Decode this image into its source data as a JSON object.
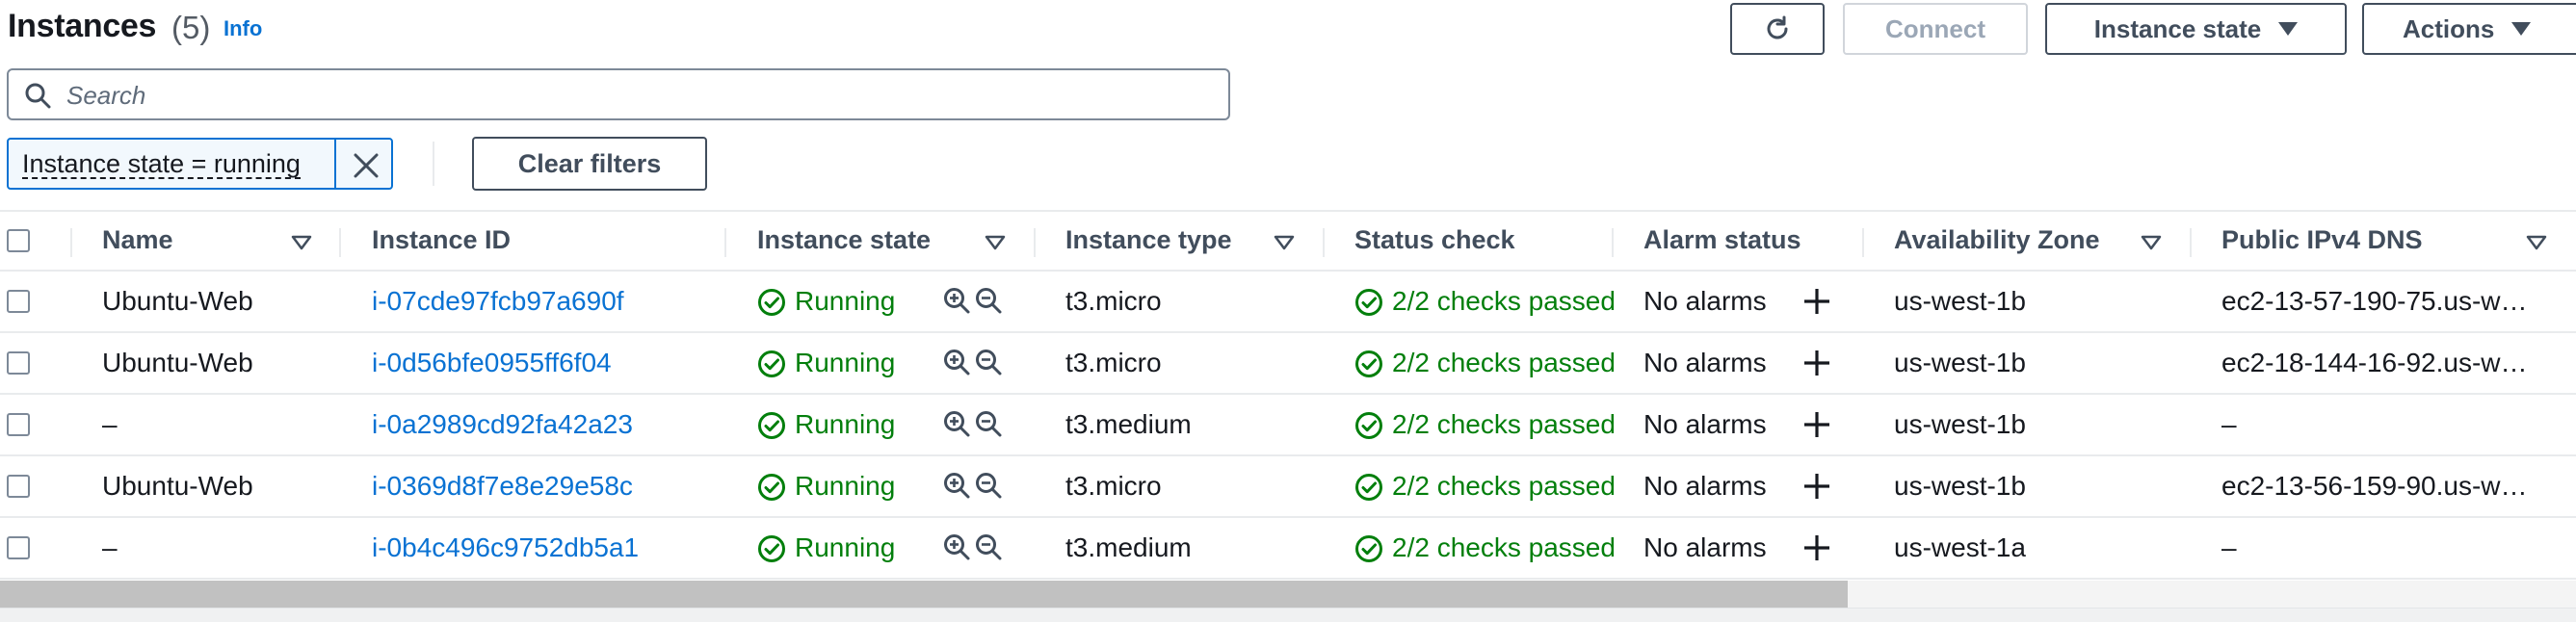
{
  "header": {
    "title": "Instances",
    "count": "(5)",
    "info": "Info",
    "refresh_icon": "refresh-icon",
    "connect_label": "Connect",
    "instance_state_label": "Instance state",
    "actions_label": "Actions"
  },
  "search": {
    "placeholder": "Search",
    "value": ""
  },
  "filter": {
    "token": "Instance state = running",
    "clear_label": "Clear filters"
  },
  "columns": {
    "name": "Name",
    "instance_id": "Instance ID",
    "instance_state": "Instance state",
    "instance_type": "Instance type",
    "status_check": "Status check",
    "alarm_status": "Alarm status",
    "availability_zone": "Availability Zone",
    "public_dns": "Public IPv4 DNS"
  },
  "rows": [
    {
      "name": "Ubuntu-Web",
      "id": "i-07cde97fcb97a690f",
      "state": "Running",
      "type": "t3.micro",
      "status": "2/2 checks passed",
      "alarm": "No alarms",
      "zone": "us-west-1b",
      "dns": "ec2-13-57-190-75.us-w…"
    },
    {
      "name": "Ubuntu-Web",
      "id": "i-0d56bfe0955ff6f04",
      "state": "Running",
      "type": "t3.micro",
      "status": "2/2 checks passed",
      "alarm": "No alarms",
      "zone": "us-west-1b",
      "dns": "ec2-18-144-16-92.us-w…"
    },
    {
      "name": "–",
      "id": "i-0a2989cd92fa42a23",
      "state": "Running",
      "type": "t3.medium",
      "status": "2/2 checks passed",
      "alarm": "No alarms",
      "zone": "us-west-1b",
      "dns": "–"
    },
    {
      "name": "Ubuntu-Web",
      "id": "i-0369d8f7e8e29e58c",
      "state": "Running",
      "type": "t3.micro",
      "status": "2/2 checks passed",
      "alarm": "No alarms",
      "zone": "us-west-1b",
      "dns": "ec2-13-56-159-90.us-w…"
    },
    {
      "name": "–",
      "id": "i-0b4c496c9752db5a1",
      "state": "Running",
      "type": "t3.medium",
      "status": "2/2 checks passed",
      "alarm": "No alarms",
      "zone": "us-west-1a",
      "dns": "–"
    }
  ],
  "colors": {
    "accent": "#0972d3",
    "success": "#037f0c",
    "text": "#16191f",
    "border": "#414d5c"
  }
}
